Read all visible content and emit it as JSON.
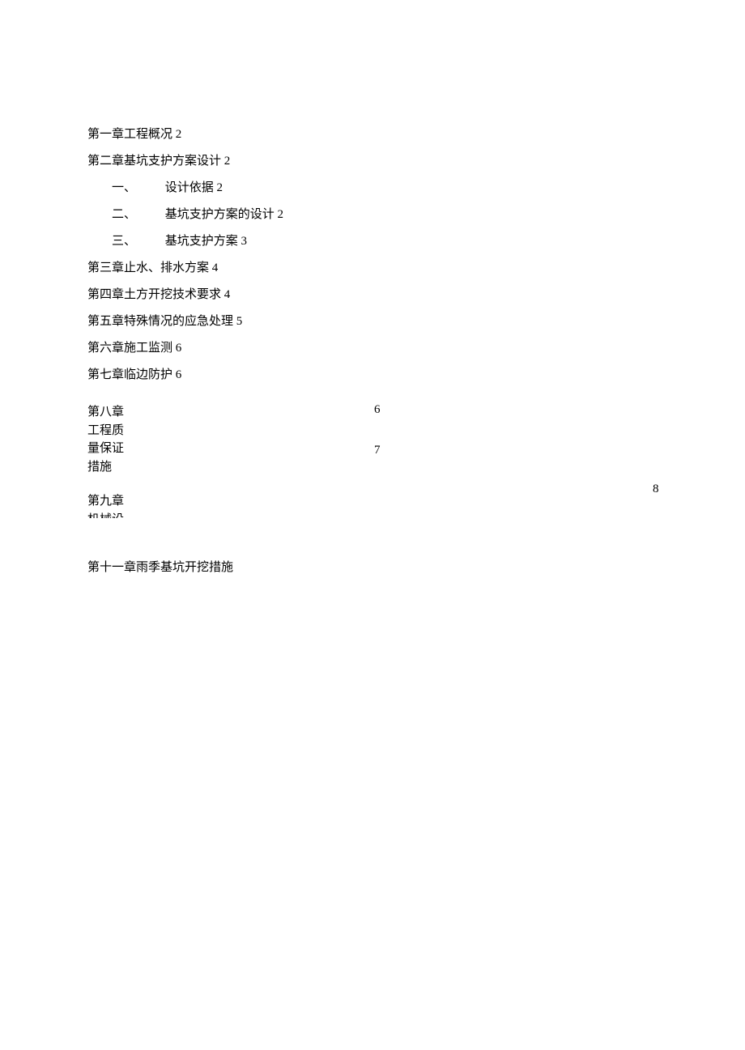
{
  "toc": {
    "items": [
      {
        "text": "第一章工程概况 2"
      },
      {
        "text": "第二章基坑支护方案设计 2"
      }
    ],
    "sub_items": [
      {
        "num": "一、",
        "text": "设计依据 2"
      },
      {
        "num": "二、",
        "text": "基坑支护方案的设计 2"
      },
      {
        "num": "三、",
        "text": "基坑支护方案 3"
      }
    ],
    "items2": [
      {
        "text": "第三章止水、排水方案 4"
      },
      {
        "text": "第四章土方开挖技术要求 4"
      },
      {
        "text": "第五章特殊情况的应急处理 5"
      },
      {
        "text": "第六章施工监测 6"
      },
      {
        "text": "第七章临边防护 6"
      }
    ],
    "chapter8": {
      "text": "第八章工程质量保证措施",
      "page1": "6",
      "page2": "7"
    },
    "chapter9": {
      "text": "第九章机械设备组",
      "page": "8"
    },
    "chapter11": {
      "text": "第十一章雨季基坑开挖措施"
    }
  }
}
